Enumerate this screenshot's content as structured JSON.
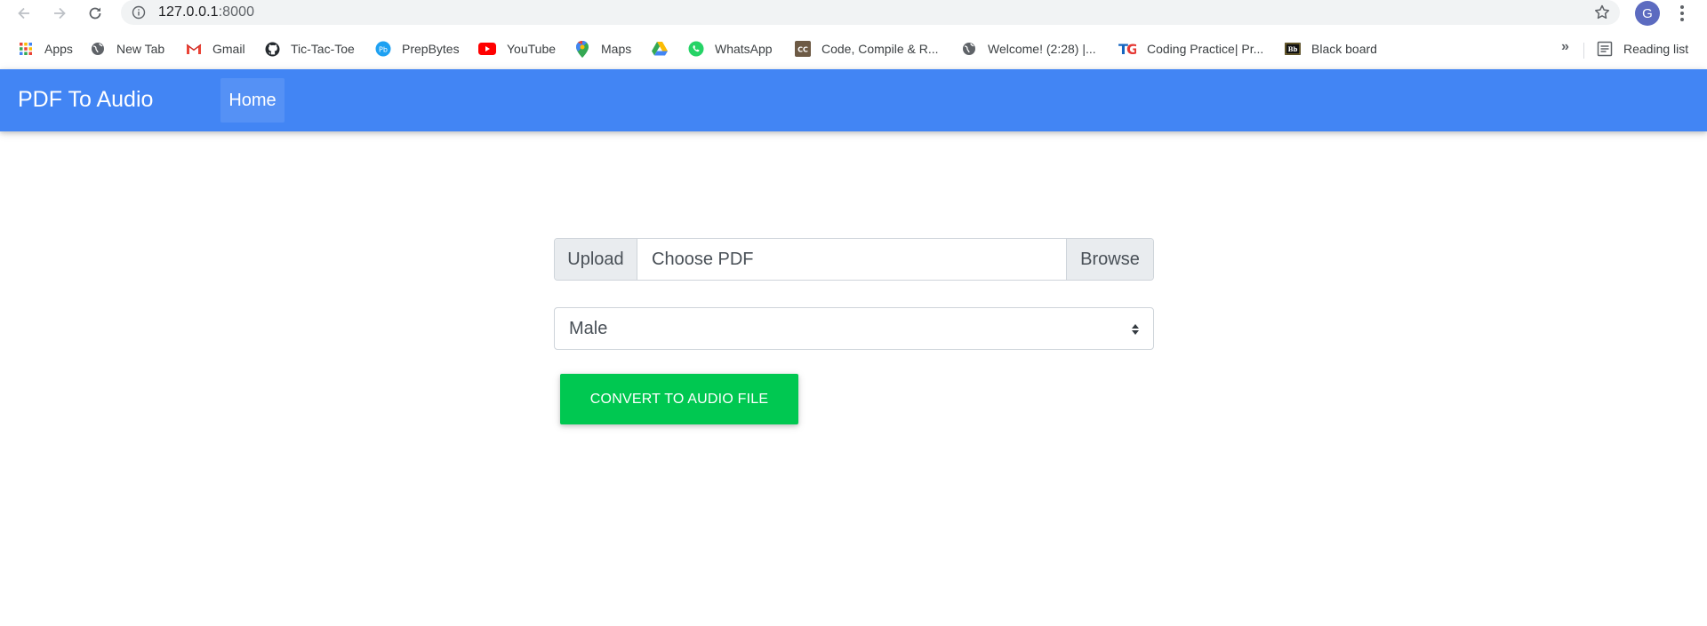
{
  "browser": {
    "url_host": "127.0.0.1",
    "url_port": ":8000",
    "profile_initial": "G",
    "bookmarks": [
      {
        "label": "Apps",
        "icon": "apps-grid-icon"
      },
      {
        "label": "New Tab",
        "icon": "globe-icon"
      },
      {
        "label": "Gmail",
        "icon": "gmail-icon"
      },
      {
        "label": "Tic-Tac-Toe",
        "icon": "github-icon"
      },
      {
        "label": "PrepBytes",
        "icon": "prepbytes-icon"
      },
      {
        "label": "YouTube",
        "icon": "youtube-icon"
      },
      {
        "label": "Maps",
        "icon": "maps-pin-icon"
      },
      {
        "label": "",
        "icon": "google-drive-icon"
      },
      {
        "label": "WhatsApp",
        "icon": "whatsapp-icon"
      },
      {
        "label": "Code, Compile & R...",
        "icon": "cc-icon"
      },
      {
        "label": "Welcome! (2:28) |...",
        "icon": "globe-icon"
      },
      {
        "label": "Coding Practice| Pr...",
        "icon": "tg-icon"
      },
      {
        "label": "Black board",
        "icon": "blackboard-icon"
      }
    ],
    "more_label": "»",
    "reading_list_label": "Reading list"
  },
  "navbar": {
    "brand": "PDF To Audio",
    "home_label": "Home",
    "color": "#4285f4"
  },
  "form": {
    "upload_prepend": "Upload",
    "file_label": "Choose PDF",
    "browse_label": "Browse",
    "voice_selected": "Male",
    "convert_label": "CONVERT TO AUDIO FILE",
    "convert_color": "#00c851"
  }
}
